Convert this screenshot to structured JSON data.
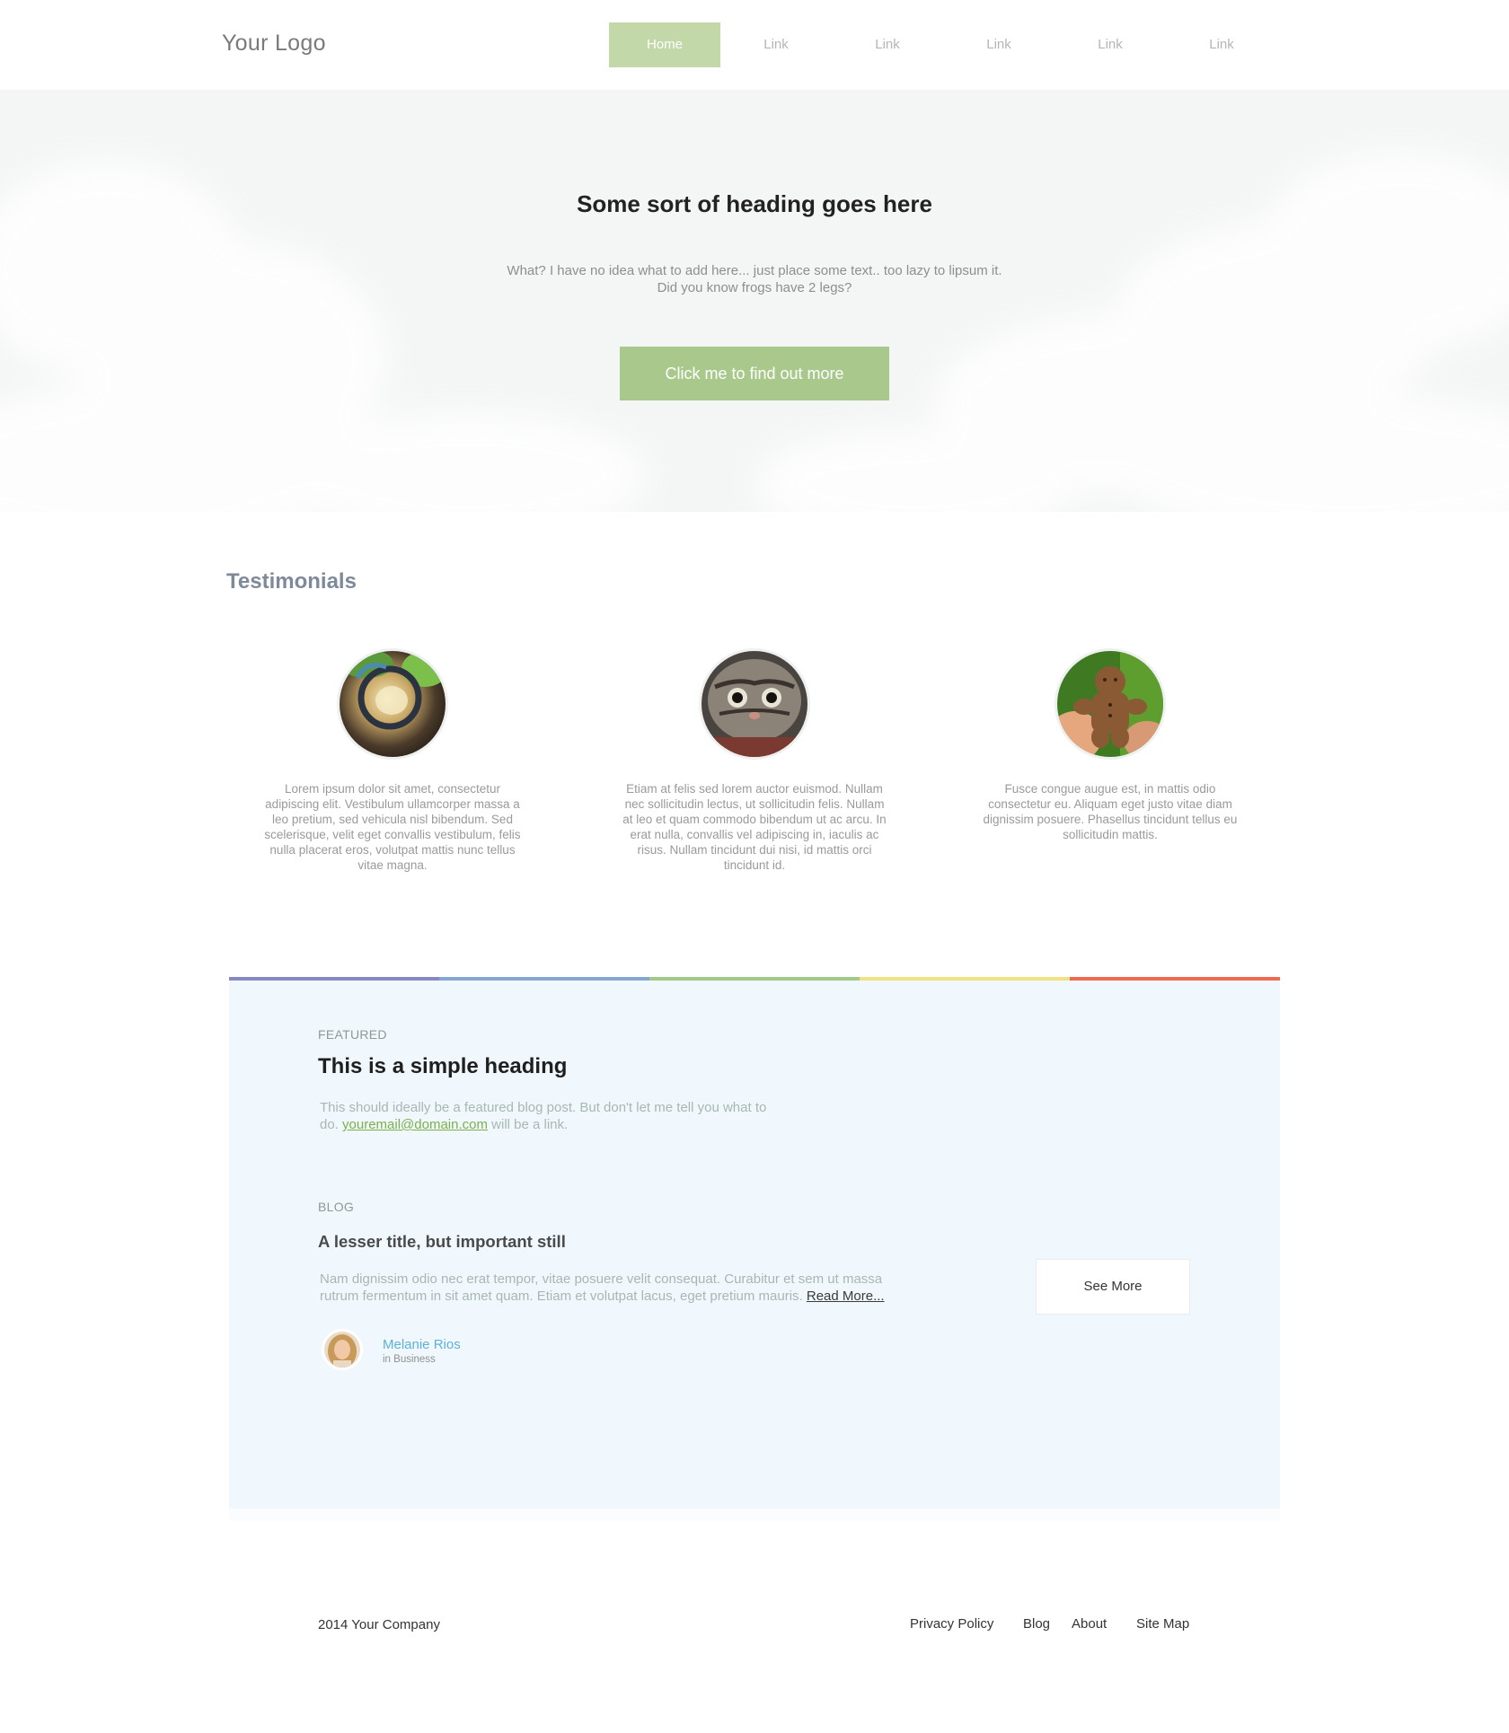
{
  "header": {
    "logo": "Your Logo",
    "nav": [
      {
        "label": "Home",
        "active": true
      },
      {
        "label": "Link",
        "active": false
      },
      {
        "label": "Link",
        "active": false
      },
      {
        "label": "Link",
        "active": false
      },
      {
        "label": "Link",
        "active": false
      },
      {
        "label": "Link",
        "active": false
      }
    ]
  },
  "hero": {
    "title": "Some sort of heading goes here",
    "text_line1": "What? I have no idea what to add here... just place some text.. too lazy to lipsum it.",
    "text_line2": "Did you know frogs have 2 legs?",
    "button": "Click me to find out more"
  },
  "testimonials": {
    "title": "Testimonials",
    "items": [
      {
        "text": "Lorem ipsum dolor sit amet, consectetur adipiscing elit. Vestibulum ullamcorper massa a leo pretium, sed vehicula nisl bibendum. Sed scelerisque, velit eget convallis vestibulum, felis nulla placerat eros, volutpat mattis nunc tellus vitae magna.",
        "image": "glasses-photo"
      },
      {
        "text": "Etiam at felis sed lorem auctor euismod. Nullam nec sollicitudin lectus, ut sollicitudin felis. Nullam at leo et quam commodo bibendum ut ac arcu. In erat nulla, convallis vel adipiscing in, iaculis ac risus. Nullam tincidunt dui nisi, id mattis orci tincidunt id.",
        "image": "cat-photo"
      },
      {
        "text": "Fusce congue augue est, in mattis odio consectetur eu. Aliquam eget justo vitae diam dignissim posuere. Phasellus tincidunt tellus eu sollicitudin mattis.",
        "image": "gingerbread-photo"
      }
    ]
  },
  "featured": {
    "tag": "FEATURED",
    "title": "This is a simple heading",
    "text_before": "This should ideally be a featured blog post. But don't let me tell you what to do. ",
    "email": "youremail@domain.com",
    "text_after": " will be a link.",
    "rainbow_colors": [
      "#8a88c4",
      "#87a7d1",
      "#a3c98a",
      "#f1e184",
      "#ef6a4f"
    ]
  },
  "blog": {
    "tag": "BLOG",
    "title": "A lesser title, but important still",
    "text": "Nam dignissim odio nec erat tempor, vitae posuere velit consequat. Curabitur et sem ut massa rutrum fermentum in sit amet quam. Etiam et volutpat lacus, eget pretium mauris. ",
    "read_more": "Read More...",
    "see_more": "See More",
    "author": {
      "name": "Melanie Rios",
      "category": "in Business"
    }
  },
  "footer": {
    "copyright": "2014 Your Company",
    "links": [
      "Privacy Policy",
      "Blog",
      "About",
      "Site Map"
    ]
  }
}
